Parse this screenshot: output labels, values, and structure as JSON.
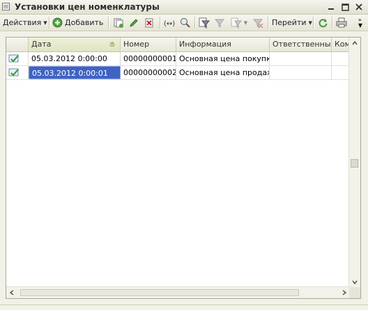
{
  "window": {
    "title": "Установки цен номенклатуры",
    "controls": [
      "minimize",
      "maximize",
      "close"
    ]
  },
  "toolbar": {
    "actions_label": "Действия",
    "add_label": "Добавить",
    "goto_label": "Перейти",
    "icons": [
      "copy-icon",
      "edit-icon",
      "delete-icon",
      "interval-icon",
      "find-icon",
      "filter-icon",
      "filter-list-icon",
      "filter-off-icon",
      "refresh-icon",
      "print-icon",
      "more-icon"
    ]
  },
  "table": {
    "columns": [
      "Дата",
      "Номер",
      "Информация",
      "Ответственный",
      "Ком"
    ],
    "sorted_column": "Дата",
    "rows": [
      {
        "date": "05.03.2012 0:00:00",
        "number": "00000000001",
        "info": "Основная цена покупки",
        "responsible": "",
        "comment": ""
      },
      {
        "date": "05.03.2012 0:00:01",
        "number": "00000000002",
        "info": "Основная цена продажи",
        "responsible": "",
        "comment": ""
      }
    ],
    "selected_row": 1
  },
  "colors": {
    "selection": "#3f63c3",
    "header_bg": "#e8e6d8",
    "window_bg": "#f2f1e7"
  }
}
